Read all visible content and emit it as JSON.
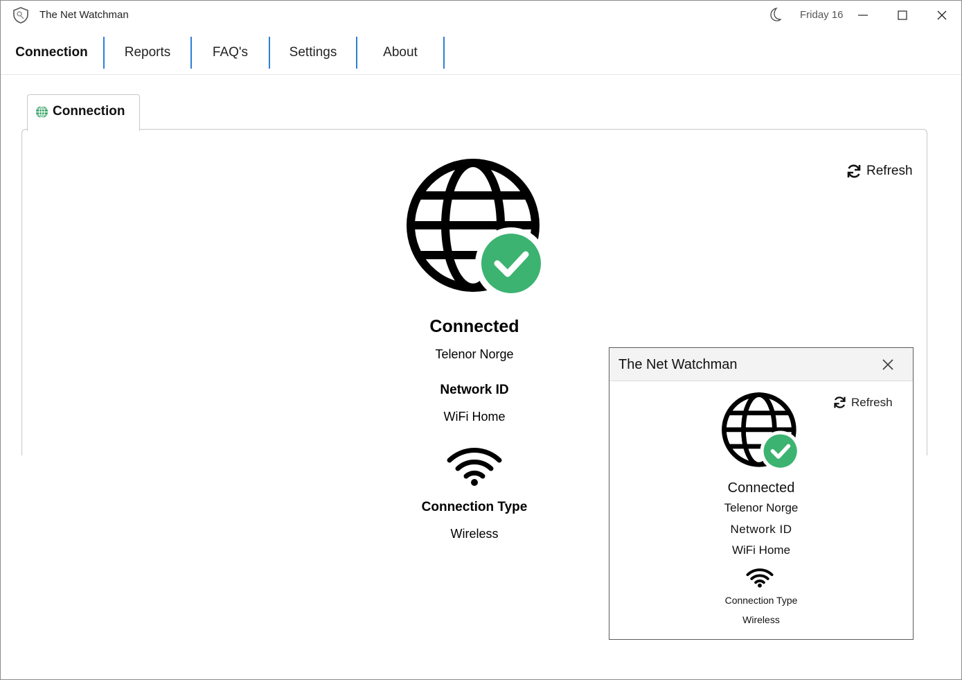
{
  "titlebar": {
    "title": "The Net Watchman",
    "date": "Friday 16"
  },
  "nav": {
    "items": [
      "Connection",
      "Reports",
      "FAQ's",
      "Settings",
      "About"
    ],
    "active": "Connection"
  },
  "tab": {
    "label": "Connection"
  },
  "main": {
    "refresh_label": "Refresh",
    "status": "Connected",
    "isp": "Telenor Norge",
    "network_id_label": "Network ID",
    "network_id_value": "WiFi Home",
    "connection_type_label": "Connection Type",
    "connection_type_value": "Wireless"
  },
  "popup": {
    "title": "The Net Watchman",
    "refresh_label": "Refresh",
    "status": "Connected",
    "isp": "Telenor Norge",
    "network_id_label": "Network ID",
    "network_id_value": "WiFi Home",
    "connection_type_label": "Connection Type",
    "connection_type_value": "Wireless"
  },
  "colors": {
    "accent": "#2e7fd1",
    "success": "#3cb371",
    "tab_icon": "#3aa56a"
  },
  "icons": {
    "app": "shield-icon",
    "theme": "moon-icon",
    "status": "globe-check-icon",
    "connection": "wifi-icon",
    "refresh": "refresh-icon"
  }
}
